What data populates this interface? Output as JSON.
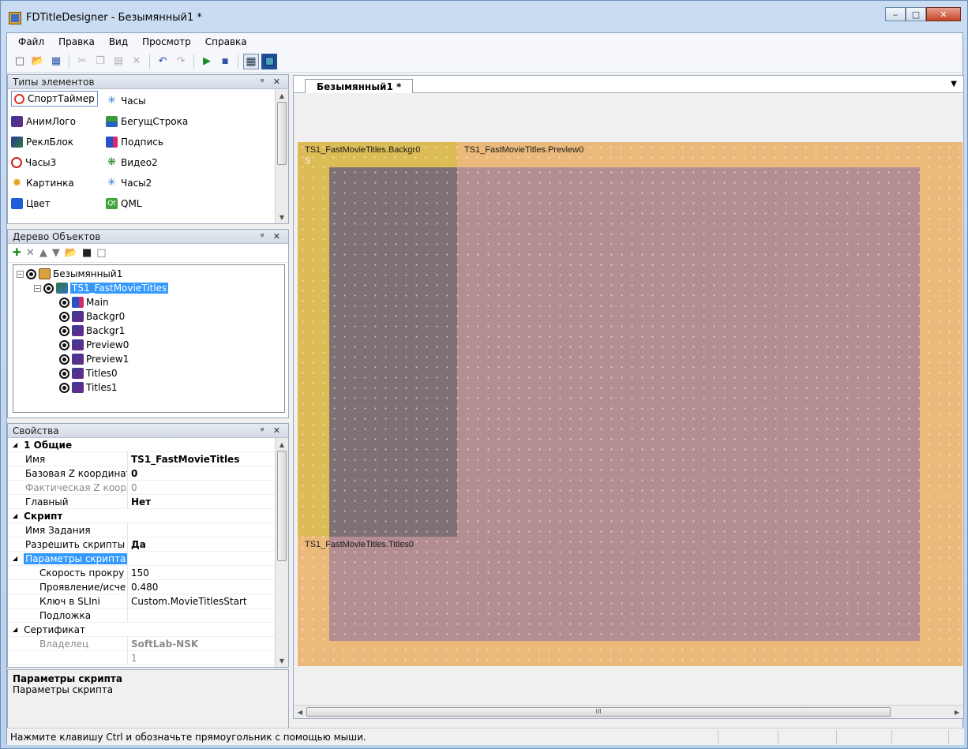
{
  "window": {
    "title": "FDTitleDesigner - Безымянный1 *",
    "minimize": "‒",
    "maximize": "□",
    "close": "✕"
  },
  "menu": [
    "Файл",
    "Правка",
    "Вид",
    "Просмотр",
    "Справка"
  ],
  "toolbar": {
    "icons": [
      "new-icon",
      "open-icon",
      "save-icon",
      "cut-icon",
      "copy-icon",
      "paste-icon",
      "delete-icon",
      "undo-icon",
      "redo-icon",
      "play-icon",
      "stop-icon",
      "grid-icon",
      "frame-icon"
    ],
    "grid_toggle_active": true,
    "frame_toggle_active": true
  },
  "element_types": {
    "title": "Типы элементов",
    "pin": "ᵠ ✕",
    "items": [
      {
        "label": "СпортТаймер",
        "icon": "stopwatch-icon",
        "color": "#d9312b"
      },
      {
        "label": "Часы",
        "icon": "clock-icon",
        "color": "#2b6fd9"
      },
      {
        "label": "АнимЛого",
        "icon": "film-icon",
        "color": "#6a2a80"
      },
      {
        "label": "БегущСтрока",
        "icon": "ticker-icon",
        "color": "#2a60c0"
      },
      {
        "label": "РеклБлок",
        "icon": "film-icon",
        "color": "#2c7a3a"
      },
      {
        "label": "Подпись",
        "icon": "caption-icon",
        "color": "#d22b6a"
      },
      {
        "label": "Часы3",
        "icon": "clock-icon",
        "color": "#c82020"
      },
      {
        "label": "Видео2",
        "icon": "video-icon",
        "color": "#2a8a30"
      },
      {
        "label": "Картинка",
        "icon": "picture-icon",
        "color": "#e8a020"
      },
      {
        "label": "Часы2",
        "icon": "clock-icon",
        "color": "#2b6fd9"
      },
      {
        "label": "Цвет",
        "icon": "color-icon",
        "color": "#1f5ed8"
      },
      {
        "label": "QML",
        "icon": "qt-icon",
        "color": "#41a33a"
      }
    ]
  },
  "object_tree": {
    "title": "Дерево Объектов",
    "pin": "ᵠ ✕",
    "nodes": [
      {
        "label": "Безымянный1",
        "level": 0,
        "expander": "⊟"
      },
      {
        "label": "TS1_FastMovieTitles",
        "level": 1,
        "expander": "⊟",
        "selected": true
      },
      {
        "label": "Main",
        "level": 2
      },
      {
        "label": "Backgr0",
        "level": 2
      },
      {
        "label": "Backgr1",
        "level": 2
      },
      {
        "label": "Preview0",
        "level": 2
      },
      {
        "label": "Preview1",
        "level": 2
      },
      {
        "label": "Titles0",
        "level": 2
      },
      {
        "label": "Titles1",
        "level": 2
      }
    ]
  },
  "properties": {
    "title": "Свойства",
    "pin": "ᵠ ✕",
    "rows": [
      {
        "kind": "cat",
        "key": "1 Общие",
        "arrow": "◢"
      },
      {
        "kind": "row",
        "key": "Имя",
        "value": "TS1_FastMovieTitles",
        "bold": true
      },
      {
        "kind": "row",
        "key": "Базовая Z координат",
        "value": "0",
        "bold": true
      },
      {
        "kind": "row",
        "key": "Фактическая Z коорд",
        "value": "0",
        "dim": true
      },
      {
        "kind": "row",
        "key": "Главный",
        "value": "Нет",
        "bold": true
      },
      {
        "kind": "cat",
        "key": "Скрипт",
        "arrow": "◢"
      },
      {
        "kind": "row",
        "key": "Имя Задания",
        "value": ""
      },
      {
        "kind": "row",
        "key": "Разрешить скрипты",
        "value": "Да",
        "bold": true
      },
      {
        "kind": "sel",
        "key": "Параметры скрипта",
        "arrow": "◢"
      },
      {
        "kind": "sub",
        "key": "Скорость прокру",
        "value": "150"
      },
      {
        "kind": "sub",
        "key": "Проявление/исче",
        "value": "0.480"
      },
      {
        "kind": "sub",
        "key": "Ключ в SLIni",
        "value": "Custom.MovieTitlesStart"
      },
      {
        "kind": "sub",
        "key": "Подложка",
        "value": ""
      },
      {
        "kind": "cat2",
        "key": "Сертификат",
        "arrow": "◢"
      },
      {
        "kind": "sub",
        "key": "Владелец",
        "value": "SoftLab-NSK",
        "dim": true,
        "bold": true
      },
      {
        "kind": "sub",
        "key": "",
        "value": "1",
        "dim": true
      }
    ]
  },
  "description": {
    "title": "Параметры скрипта",
    "body": "Параметры скрипта"
  },
  "document": {
    "tab_label": "Безымянный1 *",
    "dropdown": "▼",
    "labels": {
      "backgr": "TS1_FastMovieTitles.Backgr0",
      "preview": "TS1_FastMovieTitles.Preview0",
      "titles": "TS1_FastMovieTitles.Titles0",
      "s_marker": "S"
    },
    "colors": {
      "outer": "#ebb97a",
      "backgr": "#dcbc55",
      "preview": "#b48d92",
      "dark": "#7e7075"
    },
    "scroll_mark": "III"
  },
  "status": {
    "text": "Нажмите клавишу Ctrl и обозначьте прямоугольник с помощью мыши."
  }
}
